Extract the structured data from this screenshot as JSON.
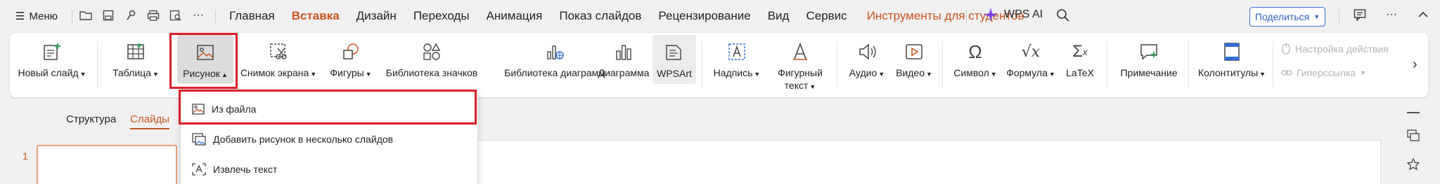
{
  "menubar": {
    "menu_label": "Меню",
    "tabs": [
      {
        "label": "Главная"
      },
      {
        "label": "Вставка"
      },
      {
        "label": "Дизайн"
      },
      {
        "label": "Переходы"
      },
      {
        "label": "Анимация"
      },
      {
        "label": "Показ слайдов"
      },
      {
        "label": "Рецензирование"
      },
      {
        "label": "Вид"
      },
      {
        "label": "Сервис"
      },
      {
        "label": "Инструменты для студентов"
      }
    ],
    "active_tab": "Вставка",
    "wps_ai": "WPS AI",
    "share_label": "Поделиться",
    "accent_color": "#c9541f"
  },
  "ribbon": {
    "new_slide": "Новый слайд",
    "table": "Таблица",
    "picture": "Рисунок",
    "screenshot": "Снимок экрана",
    "shapes": "Фигуры",
    "icon_library": "Библиотека значков",
    "chart_library": "Библиотека диаграмм",
    "chart": "Диаграмма",
    "wpsart": "WPSArt",
    "textbox": "Надпись",
    "wordart_line1": "Фигурный",
    "wordart_line2": "текст",
    "audio": "Аудио",
    "video": "Видео",
    "symbol": "Символ",
    "formula": "Формула",
    "latex": "LaTeX",
    "comment": "Примечание",
    "header_footer": "Колонтитулы",
    "action_settings": "Настройка действия",
    "hyperlink": "Гиперссылка"
  },
  "panel": {
    "tab_outline": "Структура",
    "tab_slides": "Слайды",
    "slide_number": "1"
  },
  "dropdown": {
    "items": [
      {
        "label": "Из файла",
        "icon": "image-file-icon"
      },
      {
        "label": "Добавить рисунок в несколько слайдов",
        "icon": "multi-image-icon"
      },
      {
        "label": "Извлечь текст",
        "icon": "extract-text-icon"
      }
    ],
    "highlight_color": "#d81f26"
  }
}
